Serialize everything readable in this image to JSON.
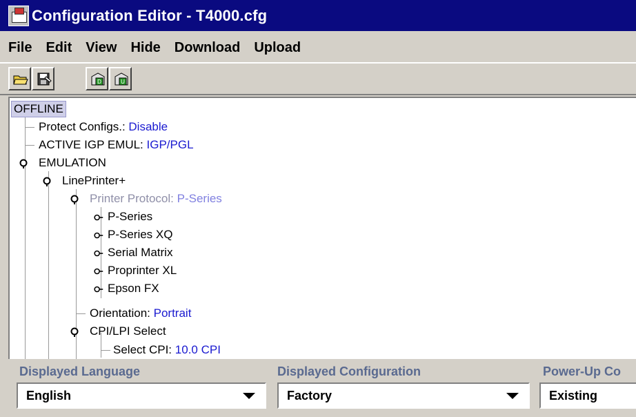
{
  "window": {
    "title": "Configuration Editor - T4000.cfg",
    "app_icon": "printer-app-icon"
  },
  "menu": [
    "File",
    "Edit",
    "View",
    "Hide",
    "Download",
    "Upload"
  ],
  "toolbar": {
    "buttons": [
      "open-folder-icon",
      "save-config-icon",
      "download-icon",
      "upload-icon"
    ]
  },
  "tree": {
    "root": "OFFLINE",
    "protect": {
      "label": "Protect Configs.:",
      "value": "Disable"
    },
    "active_igp": {
      "label": "ACTIVE IGP EMUL:",
      "value": "IGP/PGL"
    },
    "emulation": "EMULATION",
    "lineprinter": "LinePrinter+",
    "protocol": {
      "label": "Printer Protocol:",
      "value": "P-Series"
    },
    "protocols": [
      "P-Series",
      "P-Series XQ",
      "Serial Matrix",
      "Proprinter XL",
      "Epson FX"
    ],
    "orientation": {
      "label": "Orientation:",
      "value": "Portrait"
    },
    "cpi_lpi": "CPI/LPI Select",
    "select_cpi": {
      "label": "Select CPI:",
      "value": "10.0 CPI"
    }
  },
  "bottom": {
    "language": {
      "label": "Displayed Language",
      "value": "English"
    },
    "configuration": {
      "label": "Displayed Configuration",
      "value": "Factory"
    },
    "powerup": {
      "label": "Power-Up Co",
      "value": "Existing"
    }
  }
}
